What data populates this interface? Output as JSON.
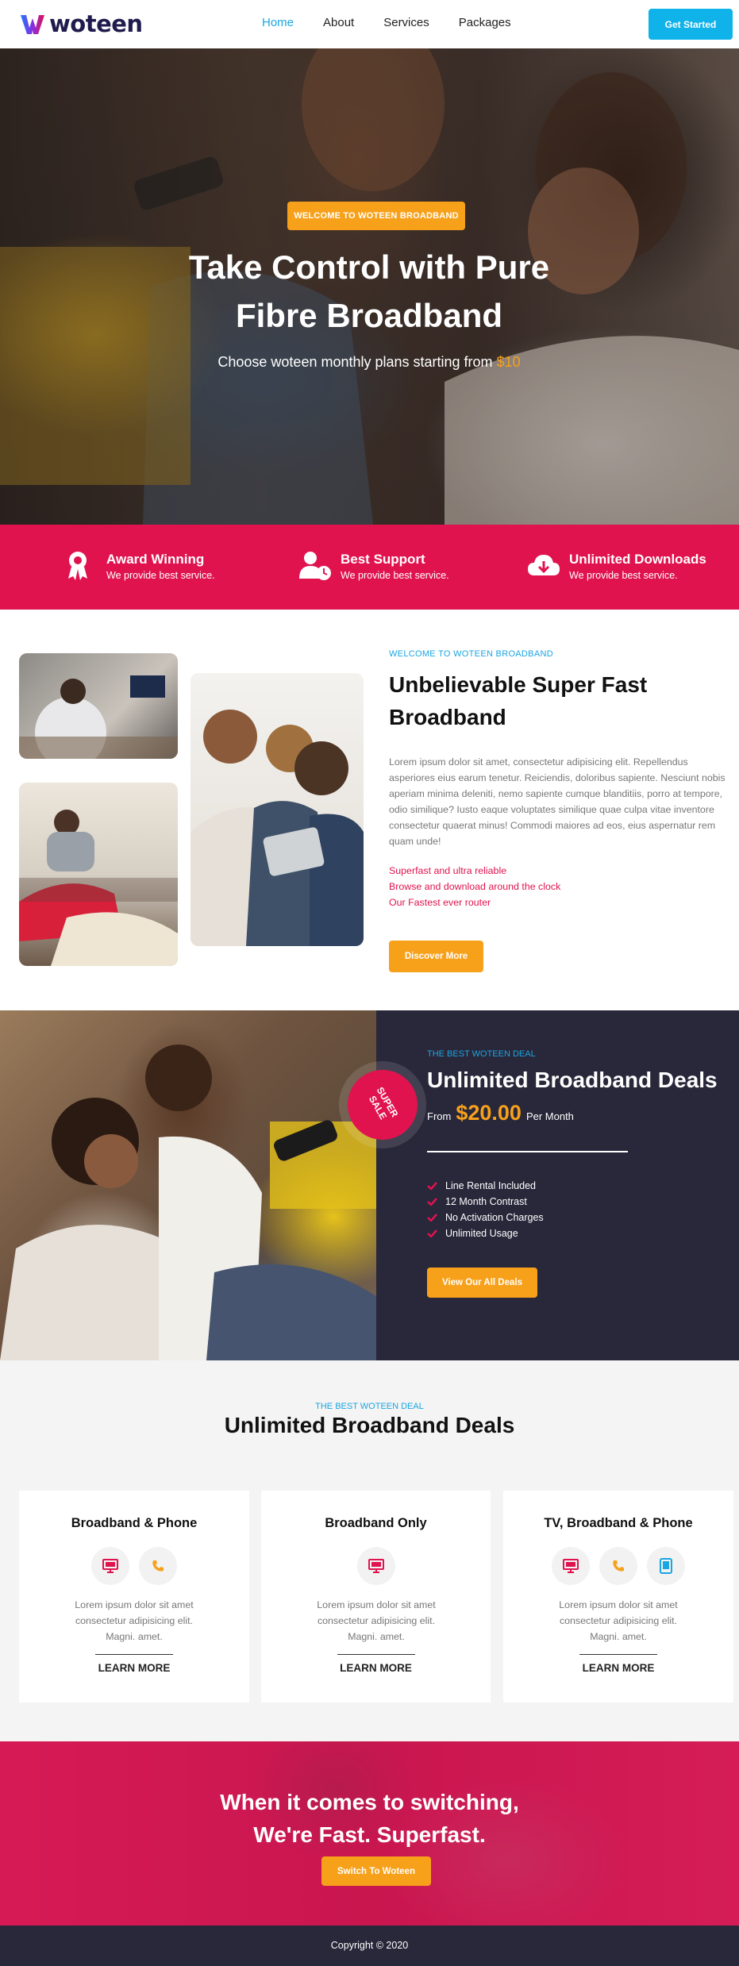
{
  "nav": {
    "logo_text": "woteen",
    "items": [
      {
        "label": "Home",
        "active": true
      },
      {
        "label": "About",
        "active": false
      },
      {
        "label": "Services",
        "active": false
      },
      {
        "label": "Packages",
        "active": false
      }
    ],
    "cta_label": "Get Started"
  },
  "hero": {
    "badge": "WELCOME TO WOTEEN BROADBAND",
    "title_line1": "Take Control with Pure",
    "title_line2": "Fibre Broadband",
    "subtitle": "Choose woteen monthly plans starting from",
    "price": "$10"
  },
  "features": [
    {
      "title": "Award Winning",
      "text": "We provide best service.",
      "icon": "award-icon"
    },
    {
      "title": "Best Support",
      "text": "We provide best service.",
      "icon": "support-icon"
    },
    {
      "title": "Unlimited Downloads",
      "text": "We provide best service.",
      "icon": "cloud-download-icon"
    }
  ],
  "about": {
    "kicker": "WELCOME TO WOTEEN BROADBAND",
    "title_line1": "Unbelievable Super Fast",
    "title_line2": "Broadband",
    "body": "Lorem ipsum dolor sit amet, consectetur adipisicing elit. Repellendus asperiores eius earum tenetur. Reiciendis, doloribus sapiente. Nesciunt nobis aperiam minima deleniti, nemo sapiente cumque blanditiis, porro at tempore, odio similique? Iusto eaque voluptates similique quae culpa vitae inventore consectetur quaerat minus! Commodi maiores ad eos, eius aspernatur rem quam unde!",
    "list": [
      "Superfast and ultra reliable",
      "Browse and download around the clock",
      "Our Fastest ever router"
    ],
    "button": "Discover More"
  },
  "deal": {
    "sale_line1": "SUPER",
    "sale_line2": "SALE",
    "kicker": "THE BEST WOTEEN DEAL",
    "title": "Unlimited Broadband Deals",
    "from": "From",
    "amount": "$20.00",
    "period": "Per Month",
    "list": [
      "Line Rental Included",
      "12 Month Contrast",
      "No Activation Charges",
      "Unlimited Usage"
    ],
    "button": "View Our All Deals"
  },
  "packages": {
    "kicker": "THE BEST WOTEEN DEAL",
    "title": "Unlimited Broadband Deals",
    "cards": [
      {
        "title": "Broadband & Phone",
        "text_line1": "Lorem ipsum dolor sit amet",
        "text_line2": "consectetur adipisicing elit.",
        "text_line3": "Magni. amet.",
        "more": "LEARN MORE",
        "icons": [
          "monitor-icon",
          "phone-icon"
        ]
      },
      {
        "title": "Broadband Only",
        "text_line1": "Lorem ipsum dolor sit amet",
        "text_line2": "consectetur adipisicing elit.",
        "text_line3": "Magni. amet.",
        "more": "LEARN MORE",
        "icons": [
          "monitor-icon"
        ]
      },
      {
        "title": "TV, Broadband & Phone",
        "text_line1": "Lorem ipsum dolor sit amet",
        "text_line2": "consectetur adipisicing elit.",
        "text_line3": "Magni. amet.",
        "more": "LEARN MORE",
        "icons": [
          "monitor-icon",
          "phone-icon",
          "tablet-icon"
        ]
      }
    ]
  },
  "switch": {
    "title_line1": "When it comes to switching,",
    "title_line2": "We're Fast. Superfast.",
    "button": "Switch To Woteen"
  },
  "footer": {
    "copyright": "Copyright © 2020"
  },
  "colors": {
    "accent_blue": "#0fb3ea",
    "brand_red": "#e0134f",
    "orange": "#f7a11b",
    "navy": "#29273a"
  }
}
